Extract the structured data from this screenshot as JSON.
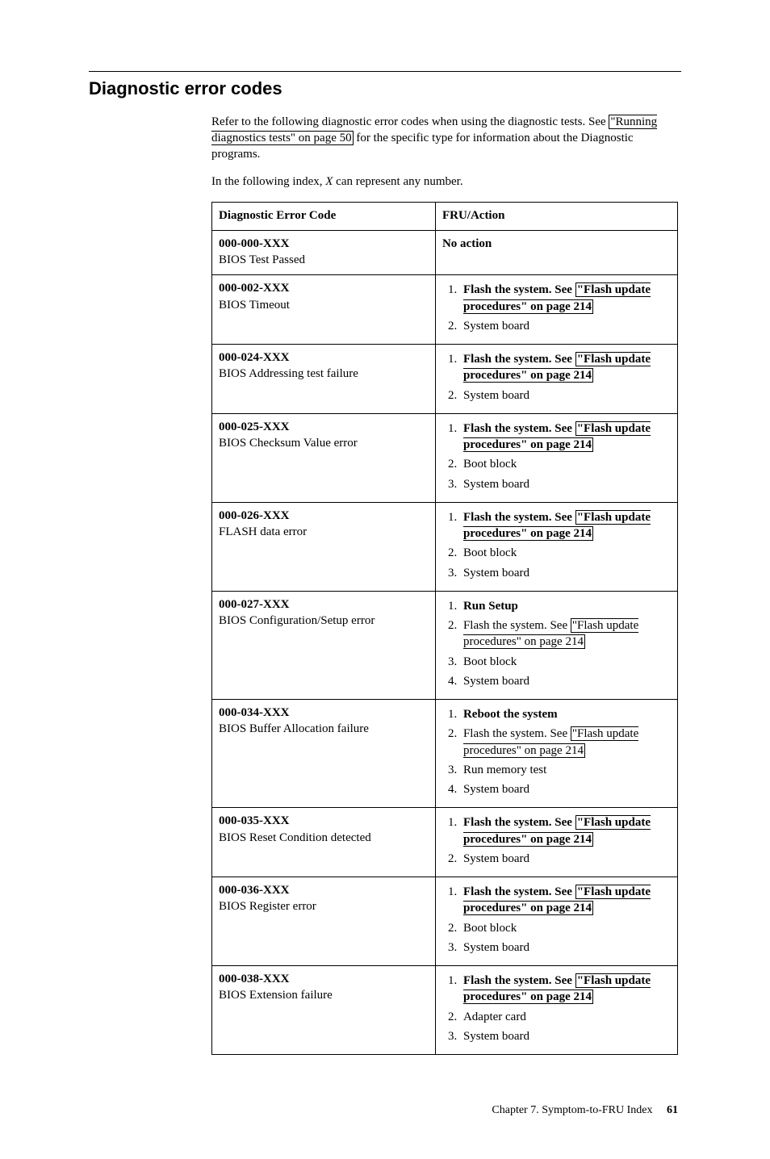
{
  "title": "Diagnostic error codes",
  "intro": {
    "line1a": "Refer to the following diagnostic error codes when using the diagnostic tests. See ",
    "link1": "\"Running diagnostics tests\" on page 50",
    "line1b": " for the specific type for information about the Diagnostic programs.",
    "note_pre": "In the following index, ",
    "note_var": "X",
    "note_post": " can represent any number."
  },
  "table": {
    "head_code": "Diagnostic Error Code",
    "head_action": "FRU/Action",
    "link_flash": "\"Flash update procedures\" on page 214",
    "rows": [
      {
        "code": "000-000-XXX",
        "desc": "BIOS Test Passed",
        "simple": "No action"
      },
      {
        "code": "000-002-XXX",
        "desc": "BIOS Timeout",
        "actions": [
          {
            "bold": true,
            "flash": true
          },
          {
            "text": "System board"
          }
        ]
      },
      {
        "code": "000-024-XXX",
        "desc": "BIOS Addressing test failure",
        "actions": [
          {
            "bold": true,
            "flash": true
          },
          {
            "text": "System board"
          }
        ]
      },
      {
        "code": "000-025-XXX",
        "desc": "BIOS Checksum Value error",
        "actions": [
          {
            "bold": true,
            "flash": true
          },
          {
            "text": "Boot block"
          },
          {
            "text": "System board"
          }
        ]
      },
      {
        "code": "000-026-XXX",
        "desc": "FLASH data error",
        "actions": [
          {
            "bold": true,
            "flash": true
          },
          {
            "text": "Boot block"
          },
          {
            "text": "System board"
          }
        ]
      },
      {
        "code": "000-027-XXX",
        "desc": "BIOS Configuration/Setup error",
        "actions": [
          {
            "bold": true,
            "text": "Run Setup"
          },
          {
            "flash": true
          },
          {
            "text": "Boot block"
          },
          {
            "text": "System board"
          }
        ]
      },
      {
        "code": "000-034-XXX",
        "desc": "BIOS Buffer Allocation failure",
        "actions": [
          {
            "bold": true,
            "text": "Reboot the system"
          },
          {
            "flash": true
          },
          {
            "text": "Run memory test"
          },
          {
            "text": "System board"
          }
        ]
      },
      {
        "code": "000-035-XXX",
        "desc": "BIOS Reset Condition detected",
        "actions": [
          {
            "bold": true,
            "flash": true
          },
          {
            "text": "System board"
          }
        ]
      },
      {
        "code": "000-036-XXX",
        "desc": "BIOS Register error",
        "actions": [
          {
            "bold": true,
            "flash": true
          },
          {
            "text": "Boot block"
          },
          {
            "text": "System board"
          }
        ]
      },
      {
        "code": "000-038-XXX",
        "desc": "BIOS Extension failure",
        "actions": [
          {
            "bold": true,
            "flash": true
          },
          {
            "text": "Adapter card"
          },
          {
            "text": "System board"
          }
        ]
      }
    ]
  },
  "footer": {
    "chapter": "Chapter 7. Symptom-to-FRU Index",
    "page": "61"
  }
}
